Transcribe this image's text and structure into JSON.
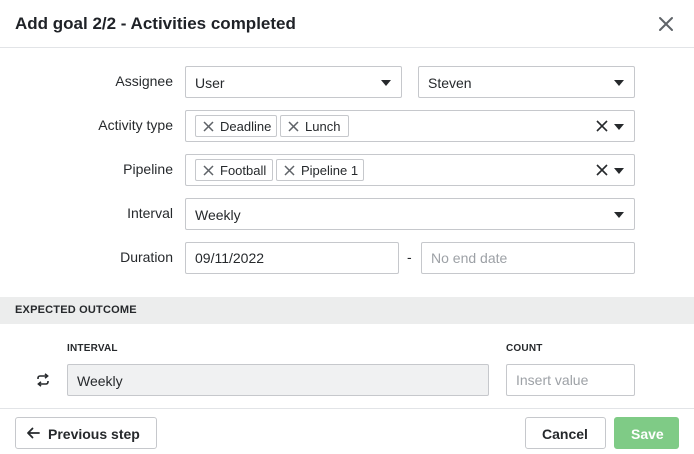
{
  "dialog": {
    "title": "Add goal 2/2 - Activities completed"
  },
  "form": {
    "assignee": {
      "label": "Assignee",
      "type_value": "User",
      "user_value": "Steven"
    },
    "activity_type": {
      "label": "Activity type",
      "chips": [
        "Deadline",
        "Lunch"
      ]
    },
    "pipeline": {
      "label": "Pipeline",
      "chips": [
        "Football",
        "Pipeline 1"
      ]
    },
    "interval": {
      "label": "Interval",
      "value": "Weekly"
    },
    "duration": {
      "label": "Duration",
      "start_value": "09/11/2022",
      "separator": "-",
      "end_placeholder": "No end date"
    }
  },
  "expected_outcome": {
    "section_title": "EXPECTED OUTCOME",
    "interval_header": "INTERVAL",
    "count_header": "COUNT",
    "interval_value": "Weekly",
    "count_placeholder": "Insert value",
    "icon": "repeat-icon"
  },
  "footer": {
    "previous_label": "Previous step",
    "cancel_label": "Cancel",
    "save_label": "Save"
  },
  "colors": {
    "save_button": "#7fcb86",
    "section_bar": "#eceded",
    "border": "#c6c8cc"
  }
}
